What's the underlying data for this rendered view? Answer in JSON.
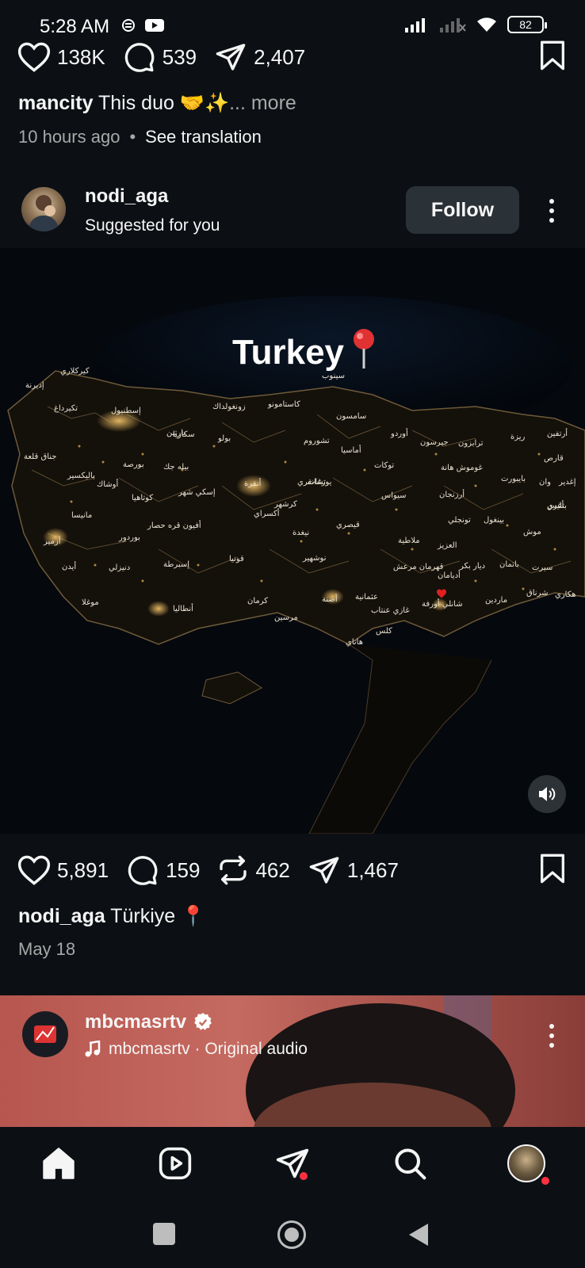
{
  "status_bar": {
    "time": "5:28 AM",
    "battery": "82",
    "icons": [
      "notification-icon",
      "youtube-icon",
      "signal-icon",
      "signal-icon",
      "wifi-icon",
      "battery-icon"
    ]
  },
  "post1": {
    "likes": "138K",
    "comments": "539",
    "shares": "2,407",
    "caption_user": "mancity",
    "caption_text": "This duo 🤝✨",
    "more": "... more",
    "time_ago": "10 hours ago",
    "see_translation": "See translation"
  },
  "post2": {
    "username": "nodi_aga",
    "suggested": "Suggested for you",
    "follow": "Follow",
    "image_title": "Turkey",
    "likes": "5,891",
    "comments": "159",
    "reposts": "462",
    "shares": "1,467",
    "caption_user": "nodi_aga",
    "caption_text": "Türkiye 📍",
    "date": "May 18",
    "cities": [
      "كيركلاري",
      "إديرنة",
      "تكيرداغ",
      "إسطنبول",
      "زونغولداك",
      "كاستامونو",
      "سينوب",
      "سامسون",
      "أوردو",
      "جيرسون",
      "ترابزون",
      "ريزة",
      "أرتفين",
      "قارص",
      "بارتين",
      "سكاريا",
      "بولو",
      "تشوروم",
      "أماسيا",
      "توكات",
      "غوموش هانة",
      "بايبورت",
      "جناق قلعة",
      "بورصة",
      "بيله جك",
      "إسكي شهر",
      "أنقرة",
      "تشانقري",
      "يوزغات",
      "سيواس",
      "أرزنجان",
      "تونجلي",
      "بينغول",
      "موش",
      "بتليس",
      "وان",
      "هكاري",
      "باليكسير",
      "مانيسا",
      "أزمير",
      "أيدن",
      "موغلا",
      "دنيزلي",
      "أوشاك",
      "كوتاهيا",
      "أفيون قره حصار",
      "إسبرطة",
      "بوردور",
      "أنطاليا",
      "قونيا",
      "كرمان",
      "أكسراي",
      "نيغدة",
      "قيصري",
      "ملاطية",
      "العزيز",
      "ديار بكر",
      "باتمان",
      "سيرت",
      "شرناق",
      "ماردين",
      "شانلي أورفة",
      "أديامان",
      "غازي عنتاب",
      "كلس",
      "هاتاي",
      "عثمانية",
      "أضنة",
      "مرسين",
      "كرشهر",
      "نوشهير",
      "قهرمان مرعش",
      "إغدير",
      "أغري"
    ]
  },
  "post3": {
    "username": "mbcmasrtv",
    "audio": "mbcmasrtv · Original audio"
  },
  "nav": {
    "items": [
      "home-icon",
      "reels-icon",
      "direct-icon",
      "search-icon",
      "profile-avatar"
    ]
  }
}
